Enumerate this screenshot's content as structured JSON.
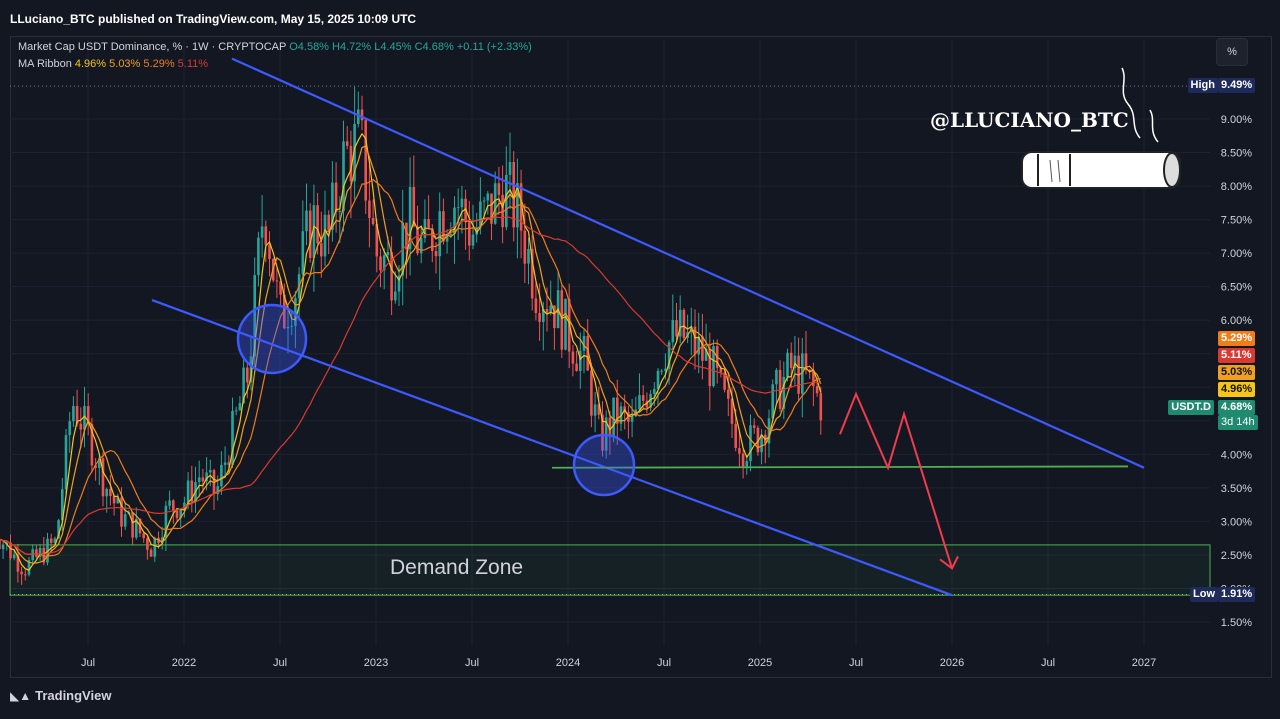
{
  "header": {
    "published": "LLuciano_BTC published on TradingView.com, May 15, 2025 10:09 UTC"
  },
  "legend": {
    "symbol": "Market Cap USDT Dominance, % · 1W · CRYPTOCAP",
    "o": "O4.58%",
    "h": "H4.72%",
    "l": "L4.45%",
    "c": "C4.68%",
    "chg": "+0.11 (+2.33%)",
    "ma_label": "MA Ribbon",
    "ma1": "4.96%",
    "ma2": "5.03%",
    "ma3": "5.29%",
    "ma4": "5.11%"
  },
  "toolbar": {
    "pct_label": "%"
  },
  "watermark": {
    "handle": "@LLUCIANO_BTC"
  },
  "annotations": {
    "demand_zone": "Demand Zone"
  },
  "footer": {
    "brand": "TradingView"
  },
  "colors": {
    "bg": "#131722",
    "up": "#26a69a",
    "down": "#ef5350",
    "ma1": "#f5c518",
    "ma2": "#f0a020",
    "ma3": "#ef7d1a",
    "ma4": "#d83a2f",
    "channel": "#3d5afe",
    "support": "#4caf50",
    "arrow": "#f03c4c"
  },
  "price_tags": [
    {
      "label": "High",
      "value": "9.49%",
      "name": "high-tag"
    },
    {
      "label": "",
      "value": "5.29%",
      "name": "ma3-tag"
    },
    {
      "label": "",
      "value": "5.11%",
      "name": "ma4-tag"
    },
    {
      "label": "",
      "value": "5.03%",
      "name": "ma2-tag"
    },
    {
      "label": "",
      "value": "4.96%",
      "name": "ma1-tag"
    },
    {
      "label": "USDT.D",
      "value": "4.68%",
      "sub": "3d 14h",
      "name": "last-price-tag"
    },
    {
      "label": "Low",
      "value": "1.91%",
      "name": "low-tag"
    }
  ],
  "chart_data": {
    "type": "candlestick",
    "title": "Market Cap USDT Dominance, % · 1W · CRYPTOCAP",
    "y_unit": "%",
    "ylim": [
      1.25,
      9.8
    ],
    "y_ticks": [
      "9.00%",
      "8.50%",
      "8.00%",
      "7.50%",
      "7.00%",
      "6.50%",
      "6.00%",
      "5.50%",
      "5.00%",
      "4.50%",
      "4.00%",
      "3.50%",
      "3.00%",
      "2.50%",
      "2.00%",
      "1.50%"
    ],
    "x_ticks": [
      "Jul",
      "2022",
      "Jul",
      "2023",
      "Jul",
      "2024",
      "Jul",
      "2025",
      "Jul",
      "2026",
      "Jul",
      "2027"
    ],
    "high": 9.49,
    "low": 1.91,
    "last": {
      "open": 4.58,
      "high": 4.72,
      "low": 4.45,
      "close": 4.68,
      "change": 0.11,
      "change_pct": 2.33
    },
    "price_path": [
      [
        "2021-01",
        2.9
      ],
      [
        "2021-03",
        2.3
      ],
      [
        "2021-05",
        2.7
      ],
      [
        "2021-06",
        4.8
      ],
      [
        "2021-07",
        4.3
      ],
      [
        "2021-08",
        3.6
      ],
      [
        "2021-09",
        3.1
      ],
      [
        "2021-10",
        2.9
      ],
      [
        "2021-11",
        2.6
      ],
      [
        "2021-12",
        3.2
      ],
      [
        "2022-01",
        3.3
      ],
      [
        "2022-02",
        3.7
      ],
      [
        "2022-03",
        3.4
      ],
      [
        "2022-04",
        4.3
      ],
      [
        "2022-05",
        5.2
      ],
      [
        "2022-06",
        7.8
      ],
      [
        "2022-07",
        6.0
      ],
      [
        "2022-08",
        6.5
      ],
      [
        "2022-09",
        7.5
      ],
      [
        "2022-10",
        7.2
      ],
      [
        "2022-11",
        8.4
      ],
      [
        "2022-12",
        8.7
      ],
      [
        "2023-01",
        7.0
      ],
      [
        "2023-02",
        6.8
      ],
      [
        "2023-03",
        7.5
      ],
      [
        "2023-04",
        7.0
      ],
      [
        "2023-05",
        7.6
      ],
      [
        "2023-06",
        7.8
      ],
      [
        "2023-07",
        7.3
      ],
      [
        "2023-08",
        7.6
      ],
      [
        "2023-09",
        8.0
      ],
      [
        "2023-10",
        7.5
      ],
      [
        "2023-11",
        6.5
      ],
      [
        "2023-12",
        6.3
      ],
      [
        "2024-01",
        5.8
      ],
      [
        "2024-02",
        5.4
      ],
      [
        "2024-03",
        4.2
      ],
      [
        "2024-04",
        4.6
      ],
      [
        "2024-05",
        4.4
      ],
      [
        "2024-06",
        5.0
      ],
      [
        "2024-07",
        5.6
      ],
      [
        "2024-08",
        5.8
      ],
      [
        "2024-09",
        5.6
      ],
      [
        "2024-10",
        5.3
      ],
      [
        "2024-11",
        4.6
      ],
      [
        "2024-12",
        4.1
      ],
      [
        "2025-01",
        4.3
      ],
      [
        "2025-02",
        4.9
      ],
      [
        "2025-03",
        5.3
      ],
      [
        "2025-04",
        5.1
      ],
      [
        "2025-05",
        4.68
      ]
    ],
    "ma_ribbon": [
      {
        "name": "MA1",
        "value": 4.96
      },
      {
        "name": "MA2",
        "value": 5.03
      },
      {
        "name": "MA3",
        "value": 5.29
      },
      {
        "name": "MA4",
        "value": 5.11
      }
    ],
    "drawings": {
      "upper_channel": [
        [
          "2022-04",
          9.9
        ],
        [
          "2027-01",
          3.8
        ]
      ],
      "lower_channel": [
        [
          "2021-11",
          6.3
        ],
        [
          "2026-01",
          1.9
        ]
      ],
      "support": [
        [
          "2023-12",
          3.8
        ],
        [
          "2026-12",
          3.82
        ]
      ],
      "demand_zone": [
        1.9,
        2.65
      ],
      "projection": [
        [
          "2025-06",
          4.3
        ],
        [
          "2025-07",
          4.9
        ],
        [
          "2025-09",
          3.8
        ],
        [
          "2025-10",
          4.6
        ],
        [
          "2026-01",
          2.3
        ]
      ]
    }
  }
}
